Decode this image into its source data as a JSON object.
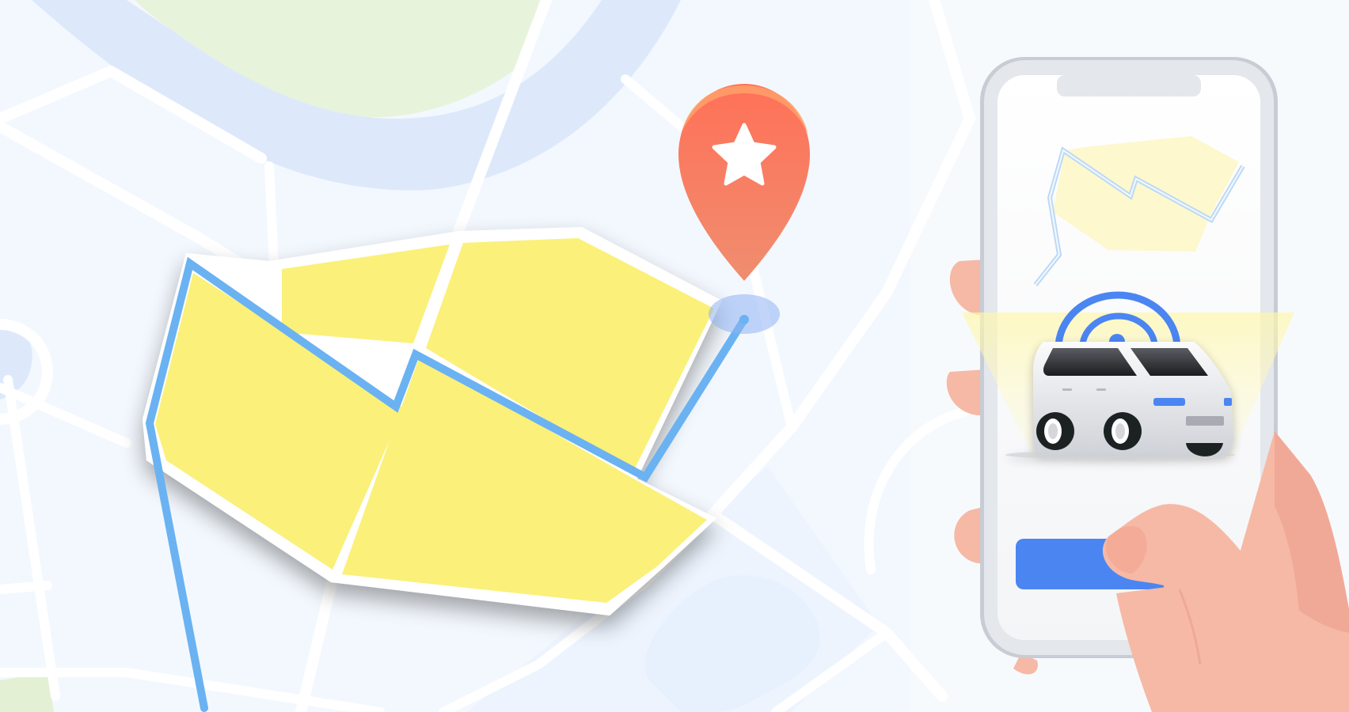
{
  "scene": {
    "type": "illustration",
    "subject": "autonomous-vehicle-service-area-map-with-phone-app",
    "map": {
      "background_color": "#f3f8fe",
      "road_color": "#ffffff",
      "water_color": "#dde9fb",
      "park_color": "#e8f3dc",
      "service_area_fill": "#fbf07a",
      "route_line_color": "#6ab2f2"
    },
    "pin": {
      "icon": "star-icon",
      "color": "#f57d62"
    },
    "phone": {
      "frame_color": "#dfe3ea",
      "screen_color": "#f7f7f8",
      "primary_button_color": "#4b85f2"
    },
    "vehicle": {
      "icon": "van-icon",
      "signal_icon": "wireless-signal-icon",
      "body_color": "#ecedf0",
      "signal_color": "#4b85f2"
    },
    "hand": {
      "skin_color": "#f6b9a5"
    }
  }
}
